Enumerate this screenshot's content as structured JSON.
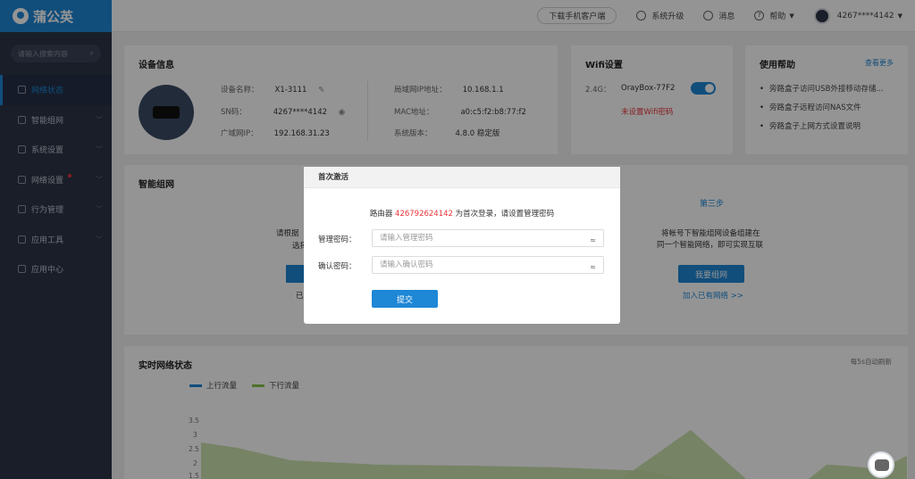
{
  "app": {
    "brand": "蒲公英"
  },
  "sidebar": {
    "search_placeholder": "请输入搜索内容",
    "items": [
      {
        "label": "网络状态"
      },
      {
        "label": "智能组网"
      },
      {
        "label": "系统设置"
      },
      {
        "label": "网络设置"
      },
      {
        "label": "行为管理"
      },
      {
        "label": "应用工具"
      },
      {
        "label": "应用中心"
      }
    ]
  },
  "topbar": {
    "download": "下载手机客户端",
    "upgrade": "系统升级",
    "message": "消息",
    "help": "帮助",
    "account": "4267****4142"
  },
  "device": {
    "title": "设备信息",
    "name_label": "设备名称：",
    "name": "X1-3111",
    "sn_label": "SN码：",
    "sn": "4267****4142",
    "wan_label": "广域网IP：",
    "wan": "192.168.31.23",
    "lan_label": "局域网IP地址：",
    "lan": "10.168.1.1",
    "mac_label": "MAC地址：",
    "mac": "a0:c5:f2:b8:77:f2",
    "ver_label": "系统版本：",
    "ver": "4.8.0 稳定版"
  },
  "wifi": {
    "title": "Wifi设置",
    "band": "2.4G：",
    "ssid": "OrayBox-77F2",
    "warning": "未设置Wifi密码"
  },
  "help": {
    "title": "使用帮助",
    "more": "查看更多",
    "items": [
      "旁路盒子访问USB外接移动存储...",
      "旁路盒子远程访问NAS文件",
      "旁路盒子上网方式设置说明"
    ]
  },
  "mesh": {
    "title": "智能组网",
    "step3": "第三步",
    "step3_desc1": "将帐号下智能组网设备组建在",
    "step3_desc2": "同一个智能网络，即可实现互联",
    "btn": "我要组网",
    "join": "加入已有网络 >>",
    "left_frag1": "请根据",
    "left_frag2": "选择",
    "left_frag3": "已"
  },
  "realtime": {
    "title": "实时网络状态",
    "refresh": "每5s自动刷新",
    "legend_up": "上行流量",
    "legend_down": "下行流量",
    "up_color": "#1e87d6",
    "down_color": "#8bc34a",
    "yticks": [
      "3.5",
      "3",
      "2.5",
      "2",
      "1.5"
    ]
  },
  "modal": {
    "title": "首次激活",
    "msg_prefix": "路由器 ",
    "msg_code": "426792624142",
    "msg_suffix": " 为首次登录，请设置管理密码",
    "pwd_label": "管理密码：",
    "pwd_placeholder": "请输入管理密码",
    "confirm_label": "确认密码：",
    "confirm_placeholder": "请输入确认密码",
    "submit": "提交"
  }
}
